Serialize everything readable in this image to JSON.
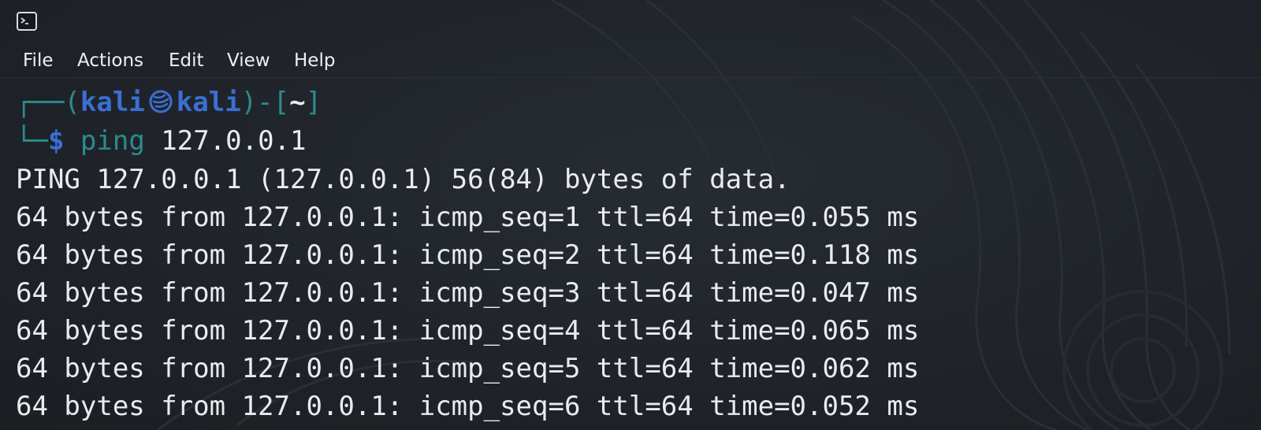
{
  "window": {
    "icon": "terminal-icon"
  },
  "menu": {
    "items": [
      "File",
      "Actions",
      "Edit",
      "View",
      "Help"
    ]
  },
  "prompt": {
    "corner_top": "┌──(",
    "user": "kali",
    "at_icon": "kali-dragon-icon",
    "host": "kali",
    "mid": ")-[",
    "path": "~",
    "end": "]",
    "corner_bottom": "└─",
    "dollar": "$",
    "command": "ping",
    "argument": "127.0.0.1"
  },
  "output": [
    "PING 127.0.0.1 (127.0.0.1) 56(84) bytes of data.",
    "64 bytes from 127.0.0.1: icmp_seq=1 ttl=64 time=0.055 ms",
    "64 bytes from 127.0.0.1: icmp_seq=2 ttl=64 time=0.118 ms",
    "64 bytes from 127.0.0.1: icmp_seq=3 ttl=64 time=0.047 ms",
    "64 bytes from 127.0.0.1: icmp_seq=4 ttl=64 time=0.065 ms",
    "64 bytes from 127.0.0.1: icmp_seq=5 ttl=64 time=0.062 ms",
    "64 bytes from 127.0.0.1: icmp_seq=6 ttl=64 time=0.052 ms"
  ],
  "colors": {
    "background": "#20242a",
    "text": "#e9ecef",
    "prompt_accent": "#3a6fd6",
    "prompt_lines": "#2a8d8e"
  }
}
